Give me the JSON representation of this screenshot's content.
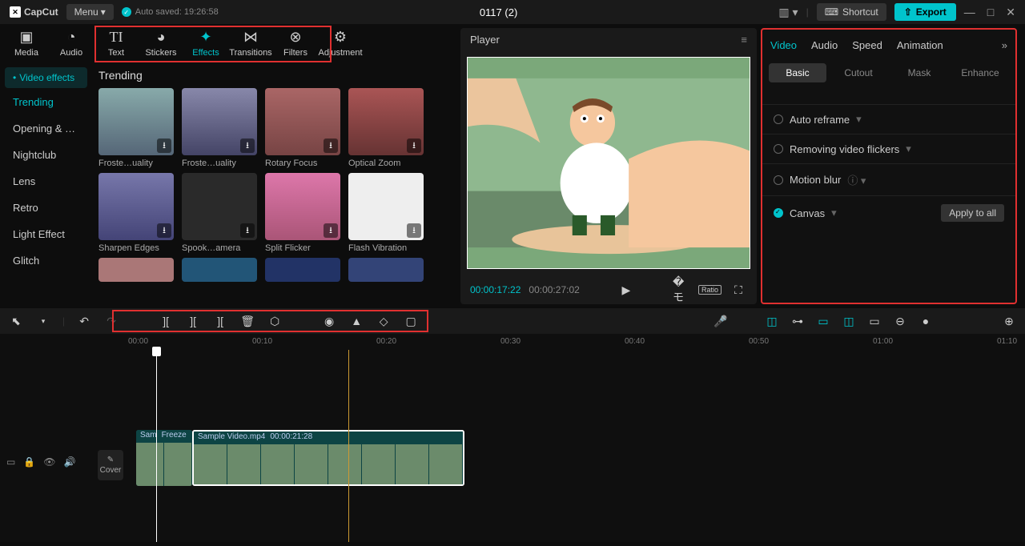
{
  "titlebar": {
    "logo": "CapCut",
    "menu": "Menu",
    "autosave": "Auto saved: 19:26:58",
    "project": "0117 (2)",
    "shortcut": "Shortcut",
    "export": "Export"
  },
  "asset_tabs": [
    "Media",
    "Audio",
    "Text",
    "Stickers",
    "Effects",
    "Transitions",
    "Filters",
    "Adjustment"
  ],
  "cat": {
    "header": "Video effects",
    "items": [
      "Trending",
      "Opening & …",
      "Nightclub",
      "Lens",
      "Retro",
      "Light Effect",
      "Glitch"
    ]
  },
  "grid": {
    "title": "Trending",
    "row1": [
      "Froste…uality",
      "Froste…uality",
      "Rotary Focus",
      "Optical Zoom"
    ],
    "row2": [
      "Sharpen Edges",
      "Spook…amera",
      "Split Flicker",
      "Flash Vibration"
    ]
  },
  "player": {
    "label": "Player",
    "cur": "00:00:17:22",
    "tot": "00:00:27:02",
    "ratio": "Ratio"
  },
  "rp": {
    "tabs": [
      "Video",
      "Audio",
      "Speed",
      "Animation"
    ],
    "subs": [
      "Basic",
      "Cutout",
      "Mask",
      "Enhance"
    ],
    "opts": [
      "Auto reframe",
      "Removing video flickers",
      "Motion blur",
      "Canvas"
    ],
    "apply": "Apply to all"
  },
  "ruler": [
    "00:00",
    "00:10",
    "00:20",
    "00:30",
    "00:40",
    "00:50",
    "01:00",
    "01:10"
  ],
  "clips": {
    "freeze_a": "Sam",
    "freeze_b": "Freeze",
    "main_name": "Sample Video.mp4",
    "main_dur": "00:00:21:28"
  },
  "cover": "Cover"
}
